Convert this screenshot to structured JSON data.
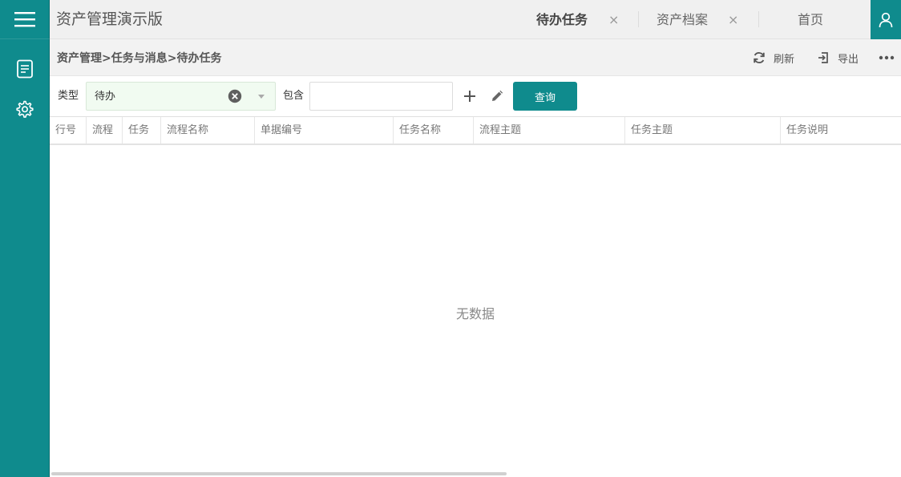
{
  "app": {
    "title": "资产管理演示版",
    "accent": "#0f8b8d"
  },
  "tabs": [
    {
      "label": "待办任务",
      "active": true,
      "closable": true
    },
    {
      "label": "资产档案",
      "active": false,
      "closable": true
    },
    {
      "label": "首页",
      "active": false,
      "closable": false
    }
  ],
  "tab_close_glyph": "×",
  "breadcrumb": "资产管理>任务与消息>待办任务",
  "toolbar": {
    "refresh_label": "刷新",
    "export_label": "导出",
    "more_icon": "more-icon"
  },
  "filters": {
    "type_label": "类型",
    "type_value": "待办",
    "contains_label": "包含",
    "contains_value": "",
    "query_label": "查询"
  },
  "grid": {
    "columns": [
      "行号",
      "流程",
      "任务",
      "流程名称",
      "单据编号",
      "任务名称",
      "流程主题",
      "任务主题",
      "任务说明"
    ],
    "rows": [],
    "empty_text": "无数据"
  },
  "sidebar": {
    "items": [
      "document-icon",
      "settings-icon"
    ]
  }
}
